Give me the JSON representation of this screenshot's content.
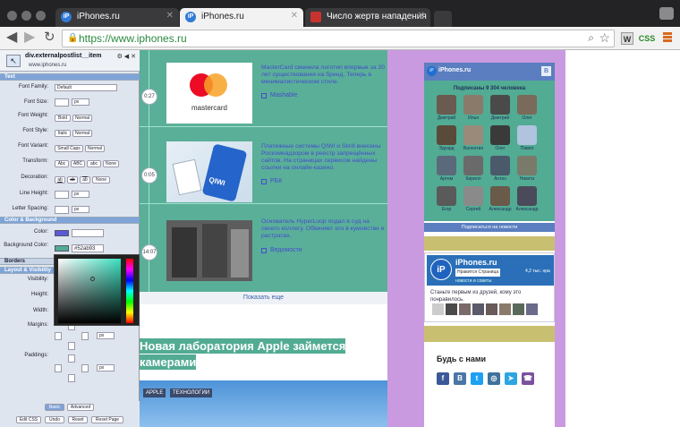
{
  "browser": {
    "tabs": [
      {
        "title": "iPhones.ru",
        "active": false
      },
      {
        "title": "iPhones.ru",
        "active": true
      },
      {
        "title": "Число жертв нападения",
        "active": false
      }
    ],
    "url": "https://www.iphones.ru",
    "extensions": {
      "w": "W",
      "css": "CSS"
    }
  },
  "panel": {
    "selector": "div.externalpostlist__item",
    "site": "www.iphones.ru",
    "sections": {
      "text": "Text",
      "color": "Color & Background",
      "borders": "Borders",
      "layout": "Layout & Visibility"
    },
    "labels": {
      "font_family": "Font Family:",
      "font_size": "Font Size:",
      "font_weight": "Font Weight:",
      "font_style": "Font Style:",
      "font_variant": "Font Variant:",
      "transform": "Transform:",
      "decoration": "Decoration:",
      "line_height": "Line Height:",
      "letter_spacing": "Letter Spacing:",
      "color": "Color:",
      "bg_color": "Background Color:",
      "visibility": "Visibility:",
      "height": "Height:",
      "width": "Width:",
      "margins": "Margins:",
      "paddings": "Paddings:"
    },
    "values": {
      "font_family": "Default",
      "unit": "px",
      "bold": "Bold",
      "normal": "Normal",
      "italic": "Italic",
      "small_caps": "Small Caps",
      "abc1": "Abc",
      "abc2": "ABC",
      "abc3": "abc",
      "none": "None",
      "ab": "ab",
      "bg_hex": "#52ab93"
    },
    "footer": {
      "basic": "Basic",
      "advanced": "Advanced",
      "edit_css": "Edit CSS",
      "undo": "Undo",
      "reset": "Reset",
      "reset_page": "Reset Page"
    }
  },
  "feed": {
    "items": [
      {
        "time": "0:27",
        "text": "MasterCard сменила логотип впервые за 20 лет существования на бренд. Теперь в минималистическом стиле.",
        "source": "Mashable"
      },
      {
        "time": "0:05",
        "text": "Платежные системы QIWI и Skrill внесены Роскомнадзором в реестр запрещённых сайтов. На страницах сервисов найдены ссылки на онлайн-казино.",
        "source": "РБК"
      },
      {
        "time": "14:07",
        "text": "Основатель HyperLoop подал в суд на своего коллегу. Обвиняет его в кумовстве и растратах.",
        "source": "Ведомости"
      }
    ],
    "show_more": "Показать еще",
    "headline": "Новая лаборатория Apple займется камерами",
    "tags": [
      "APPLE",
      "ТЕХНОЛОГИИ"
    ],
    "mastercard_word": "mastercard",
    "qiwi_word": "QIWI"
  },
  "vk": {
    "name": "iPhones.ru",
    "vk_badge": "В",
    "subscribers": "Подписаны 9 304 человека",
    "members": [
      "Дмитрий",
      "Илья",
      "Дмитрий",
      "Олег",
      "Эдуард",
      "Валентин",
      "Олег",
      "Павел",
      "Артем",
      "Кирилл",
      "Антон",
      "Никита",
      "Егор",
      "Сергей",
      "Александр",
      "Александр"
    ],
    "subscribe": "Подписаться на новости"
  },
  "fb": {
    "name": "iPhones.ru",
    "like": "Нравится Страница",
    "count": "4,2 тыс. нра",
    "sub": "новости и советы",
    "text": "Станьте первым из друзей, кому это понравилось."
  },
  "social": {
    "title": "Будь с нами",
    "icons": [
      "f",
      "В",
      "t",
      "◎",
      "➤",
      "☎"
    ],
    "colors": [
      "#3b5998",
      "#4a76a8",
      "#1da1f2",
      "#3f729b",
      "#2ca5e0",
      "#7b519d"
    ]
  }
}
